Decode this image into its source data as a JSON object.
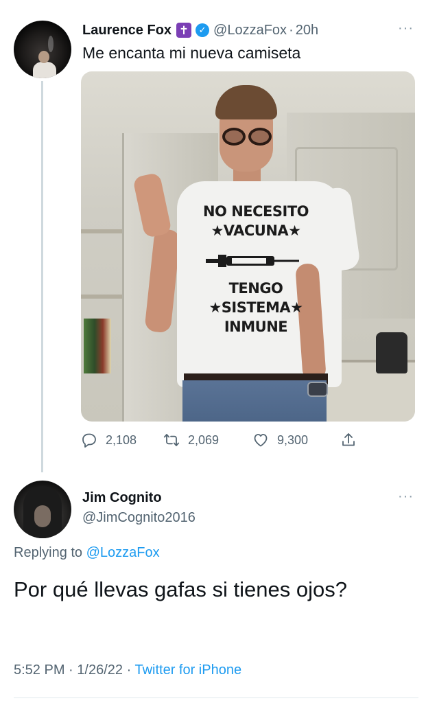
{
  "tweet": {
    "author_name": "Laurence Fox",
    "badge_glyph": "✝",
    "verified_glyph": "✓",
    "handle": "@LozzaFox",
    "separator": "·",
    "time": "20h",
    "more": "···",
    "text": "Me encanta mi nueva camiseta",
    "image": {
      "shirt_lines": [
        "NO NECESITO",
        "★VACUNA★",
        "TENGO",
        "★SISTEMA★",
        "INMUNE"
      ]
    },
    "actions": {
      "replies": "2,108",
      "retweets": "2,069",
      "likes": "9,300"
    },
    "colors": {
      "badge": "#7b3fb5",
      "verified": "#1d9bf0"
    }
  },
  "reply": {
    "author_name": "Jim Cognito",
    "handle": "@JimCognito2016",
    "more": "···",
    "replying_prefix": "Replying to ",
    "replying_mention": "@LozzaFox",
    "text": "Por qué llevas gafas si tienes ojos?",
    "time": "5:52 PM",
    "date": "1/26/22",
    "separator": "·",
    "source": "Twitter for iPhone"
  },
  "icons": [
    "reply-icon",
    "retweet-icon",
    "like-icon",
    "share-icon",
    "verified-icon",
    "cross-icon",
    "more-icon"
  ],
  "colors": {
    "link": "#1d9bf0",
    "secondary_text": "#536471",
    "text": "#0f1419"
  }
}
